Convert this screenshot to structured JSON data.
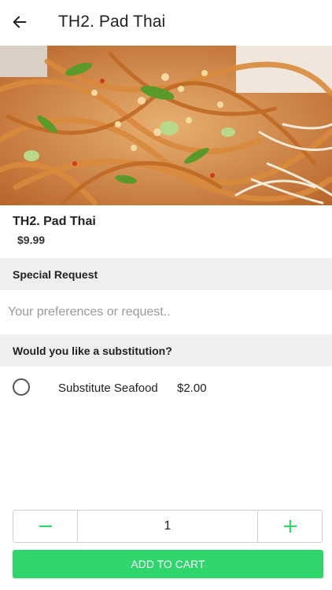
{
  "header": {
    "title": "TH2. Pad Thai",
    "back_icon": "arrow-left-icon"
  },
  "item": {
    "name": "TH2. Pad Thai",
    "price": "$9.99"
  },
  "special_request": {
    "heading": "Special Request",
    "placeholder": "Your preferences or request.."
  },
  "substitution": {
    "heading": "Would you like a substitution?",
    "options": [
      {
        "label": "Substitute Seafood",
        "price": "$2.00",
        "selected": false
      }
    ]
  },
  "quantity": {
    "value": "1",
    "minus_icon": "minus-icon",
    "plus_icon": "plus-icon"
  },
  "cart": {
    "add_label": "ADD TO CART"
  },
  "colors": {
    "accent": "#2ed66b",
    "section_bg": "#efefef"
  }
}
